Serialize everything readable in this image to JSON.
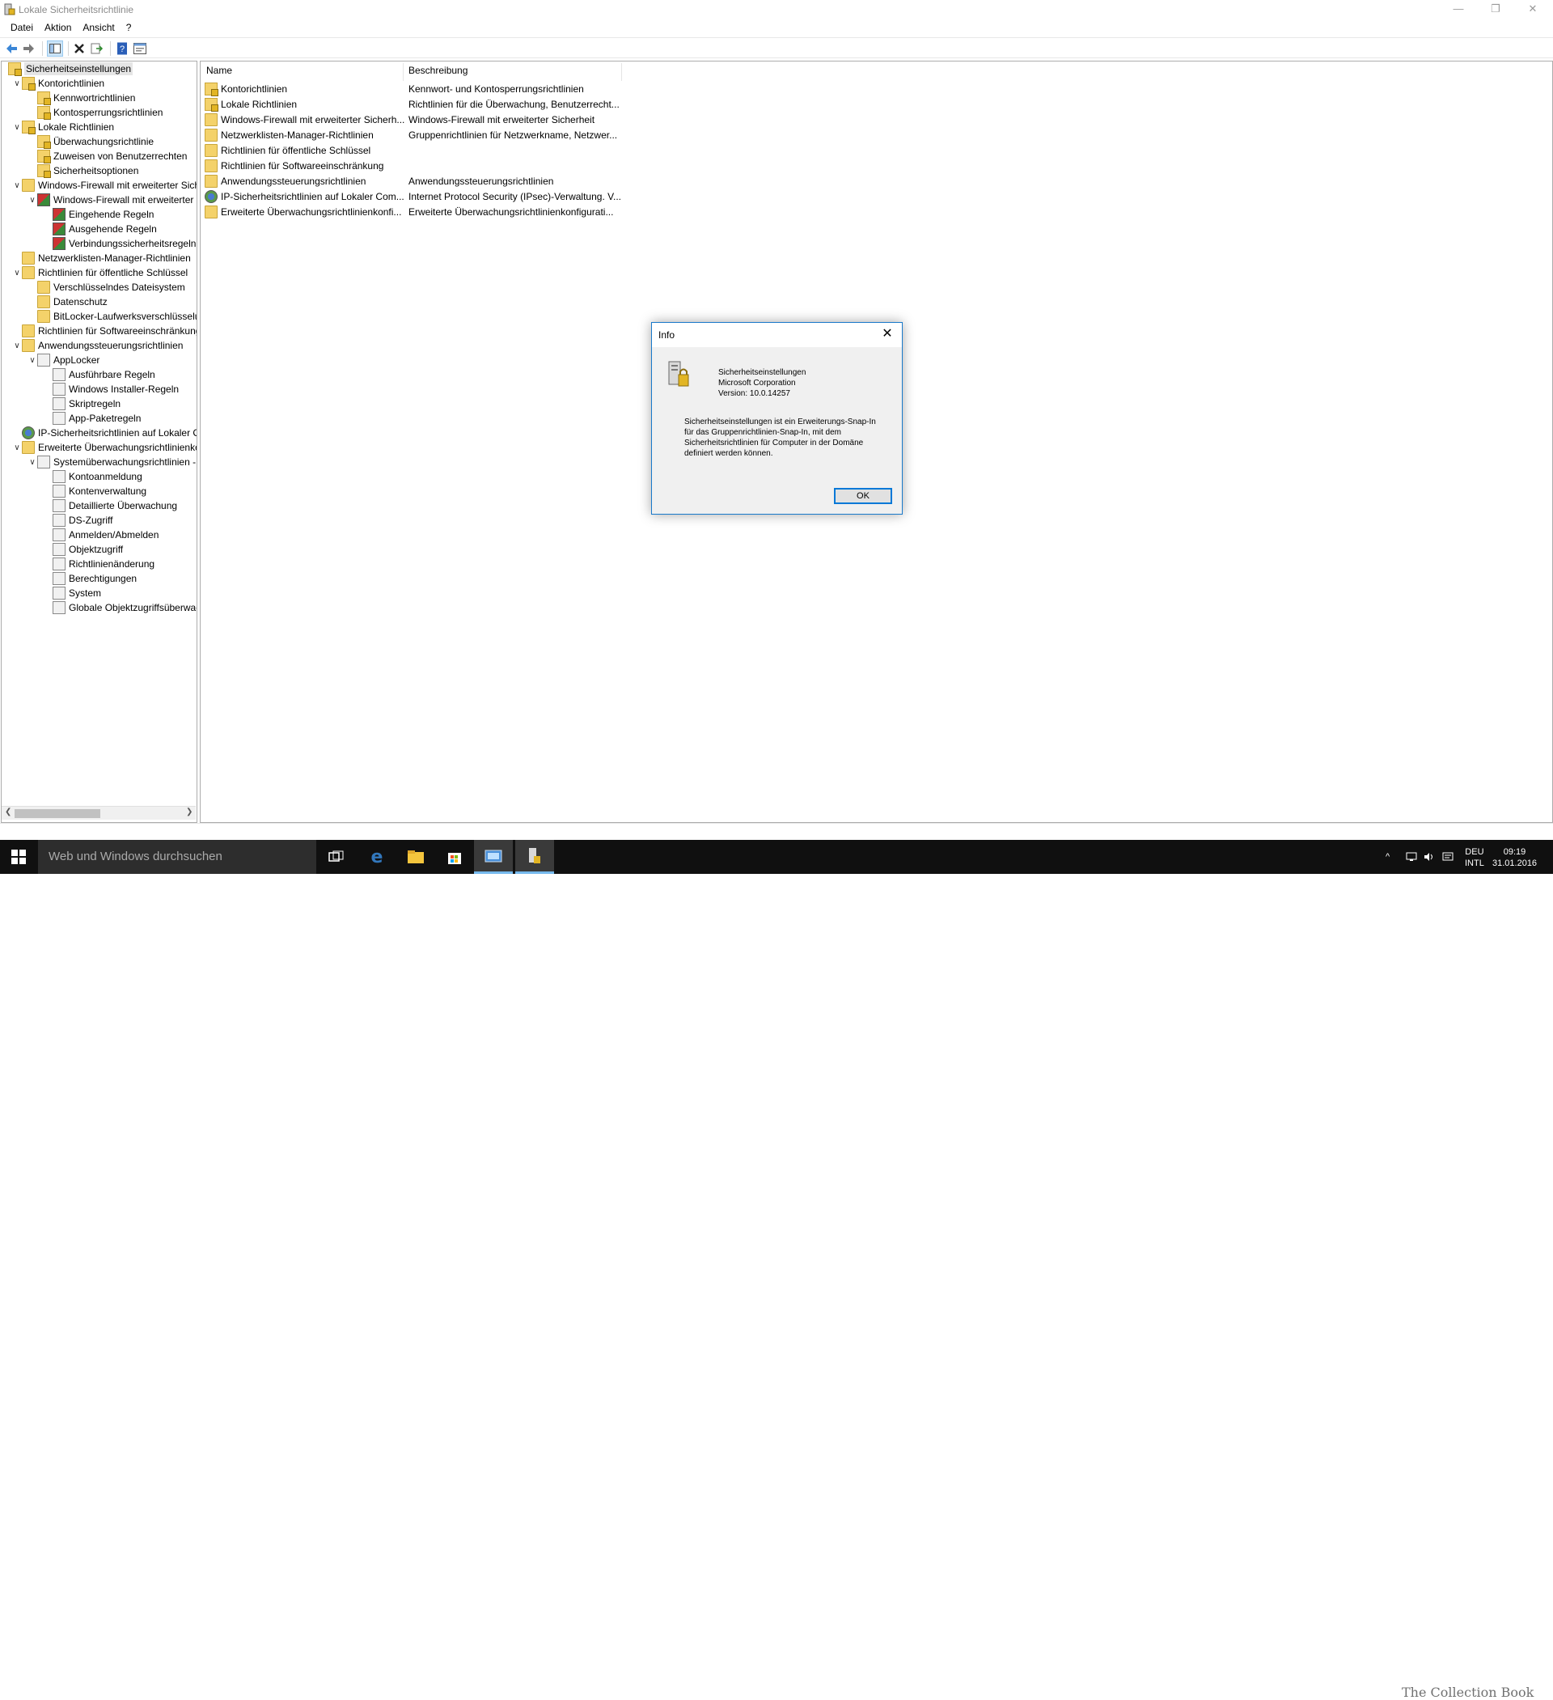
{
  "window": {
    "title": "Lokale Sicherheitsrichtlinie",
    "controls": {
      "minimize": "—",
      "restore": "❐",
      "close": "✕"
    }
  },
  "menu": [
    "Datei",
    "Aktion",
    "Ansicht",
    "?"
  ],
  "toolbar": [
    "back-icon",
    "forward-icon",
    "show-hide-tree-icon",
    "delete-icon",
    "export-icon",
    "help-icon",
    "properties-icon"
  ],
  "tree": [
    {
      "label": "Sicherheitseinstellungen",
      "level": 0,
      "exp": "",
      "icon": "lockfolder",
      "selected": true
    },
    {
      "label": "Kontorichtlinien",
      "level": 1,
      "exp": "∨",
      "icon": "lockfolder"
    },
    {
      "label": "Kennwortrichtlinien",
      "level": 2,
      "exp": "",
      "icon": "lockfolder"
    },
    {
      "label": "Kontosperrungsrichtlinien",
      "level": 2,
      "exp": "",
      "icon": "lockfolder"
    },
    {
      "label": "Lokale Richtlinien",
      "level": 1,
      "exp": "∨",
      "icon": "lockfolder"
    },
    {
      "label": "Überwachungsrichtlinie",
      "level": 2,
      "exp": "",
      "icon": "lockfolder"
    },
    {
      "label": "Zuweisen von Benutzerrechten",
      "level": 2,
      "exp": "",
      "icon": "lockfolder"
    },
    {
      "label": "Sicherheitsoptionen",
      "level": 2,
      "exp": "",
      "icon": "lockfolder"
    },
    {
      "label": "Windows-Firewall mit erweiterter Sich",
      "level": 1,
      "exp": "∨",
      "icon": "folder"
    },
    {
      "label": "Windows-Firewall mit erweiterter",
      "level": 2,
      "exp": "∨",
      "icon": "shieldicon"
    },
    {
      "label": "Eingehende Regeln",
      "level": 3,
      "exp": "",
      "icon": "shieldicon"
    },
    {
      "label": "Ausgehende Regeln",
      "level": 3,
      "exp": "",
      "icon": "shieldicon"
    },
    {
      "label": "Verbindungssicherheitsregeln",
      "level": 3,
      "exp": "",
      "icon": "shieldicon"
    },
    {
      "label": "Netzwerklisten-Manager-Richtlinien",
      "level": 1,
      "exp": "",
      "icon": "folder"
    },
    {
      "label": "Richtlinien für öffentliche Schlüssel",
      "level": 1,
      "exp": "∨",
      "icon": "folder"
    },
    {
      "label": "Verschlüsselndes Dateisystem",
      "level": 2,
      "exp": "",
      "icon": "folder"
    },
    {
      "label": "Datenschutz",
      "level": 2,
      "exp": "",
      "icon": "folder"
    },
    {
      "label": "BitLocker-Laufwerksverschlüsselu",
      "level": 2,
      "exp": "",
      "icon": "folder"
    },
    {
      "label": "Richtlinien für Softwareeinschränkung",
      "level": 1,
      "exp": "",
      "icon": "folder"
    },
    {
      "label": "Anwendungssteuerungsrichtlinien",
      "level": 1,
      "exp": "∨",
      "icon": "folder"
    },
    {
      "label": "AppLocker",
      "level": 2,
      "exp": "∨",
      "icon": "docicon"
    },
    {
      "label": "Ausführbare Regeln",
      "level": 3,
      "exp": "",
      "icon": "docicon"
    },
    {
      "label": "Windows Installer-Regeln",
      "level": 3,
      "exp": "",
      "icon": "docicon"
    },
    {
      "label": "Skriptregeln",
      "level": 3,
      "exp": "",
      "icon": "docicon"
    },
    {
      "label": "App-Paketregeln",
      "level": 3,
      "exp": "",
      "icon": "docicon"
    },
    {
      "label": "IP-Sicherheitsrichtlinien auf Lokaler C",
      "level": 1,
      "exp": "",
      "icon": "geoicon"
    },
    {
      "label": "Erweiterte Überwachungsrichtlinienko",
      "level": 1,
      "exp": "∨",
      "icon": "folder"
    },
    {
      "label": "Systemüberwachungsrichtlinien -",
      "level": 2,
      "exp": "∨",
      "icon": "docicon"
    },
    {
      "label": "Kontoanmeldung",
      "level": 3,
      "exp": "",
      "icon": "docicon"
    },
    {
      "label": "Kontenverwaltung",
      "level": 3,
      "exp": "",
      "icon": "docicon"
    },
    {
      "label": "Detaillierte Überwachung",
      "level": 3,
      "exp": "",
      "icon": "docicon"
    },
    {
      "label": "DS-Zugriff",
      "level": 3,
      "exp": "",
      "icon": "docicon"
    },
    {
      "label": "Anmelden/Abmelden",
      "level": 3,
      "exp": "",
      "icon": "docicon"
    },
    {
      "label": "Objektzugriff",
      "level": 3,
      "exp": "",
      "icon": "docicon"
    },
    {
      "label": "Richtlinienänderung",
      "level": 3,
      "exp": "",
      "icon": "docicon"
    },
    {
      "label": "Berechtigungen",
      "level": 3,
      "exp": "",
      "icon": "docicon"
    },
    {
      "label": "System",
      "level": 3,
      "exp": "",
      "icon": "docicon"
    },
    {
      "label": "Globale Objektzugriffsüberwac",
      "level": 3,
      "exp": "",
      "icon": "docicon"
    }
  ],
  "list": {
    "columns": [
      "Name",
      "Beschreibung"
    ],
    "rows": [
      {
        "name": "Kontorichtlinien",
        "desc": "Kennwort- und Kontosperrungsrichtlinien",
        "icon": "lockfolder"
      },
      {
        "name": "Lokale Richtlinien",
        "desc": "Richtlinien für die Überwachung, Benutzerrecht...",
        "icon": "lockfolder"
      },
      {
        "name": "Windows-Firewall mit erweiterter Sicherh...",
        "desc": "Windows-Firewall mit erweiterter Sicherheit",
        "icon": "folder"
      },
      {
        "name": "Netzwerklisten-Manager-Richtlinien",
        "desc": "Gruppenrichtlinien für Netzwerkname, Netzwer...",
        "icon": "folder"
      },
      {
        "name": "Richtlinien für öffentliche Schlüssel",
        "desc": "",
        "icon": "folder"
      },
      {
        "name": "Richtlinien für Softwareeinschränkung",
        "desc": "",
        "icon": "folder"
      },
      {
        "name": "Anwendungssteuerungsrichtlinien",
        "desc": "Anwendungssteuerungsrichtlinien",
        "icon": "folder"
      },
      {
        "name": "IP-Sicherheitsrichtlinien auf Lokaler Com...",
        "desc": "Internet Protocol Security (IPsec)-Verwaltung. V...",
        "icon": "geoicon"
      },
      {
        "name": "Erweiterte Überwachungsrichtlinienkonfi...",
        "desc": "Erweiterte Überwachungsrichtlinienkonfigurati...",
        "icon": "folder"
      }
    ]
  },
  "dialog": {
    "title": "Info",
    "product": "Sicherheitseinstellungen",
    "company": "Microsoft Corporation",
    "version": "Version: 10.0.14257",
    "description": "Sicherheitseinstellungen ist ein Erweiterungs-Snap-In für das Gruppenrichtlinien-Snap-In, mit dem Sicherheitsrichtlinien für Computer in der Domäne definiert werden können.",
    "ok": "OK"
  },
  "taskbar": {
    "search_placeholder": "Web und Windows durchsuchen",
    "apps": [
      "task-view-icon",
      "edge-icon",
      "file-explorer-icon",
      "store-icon",
      "remote-desktop-icon",
      "security-policy-icon"
    ],
    "lang_top": "DEU",
    "lang_bottom": "INTL",
    "time": "09:19",
    "date": "31.01.2016",
    "watermark": "The Collection Book"
  }
}
